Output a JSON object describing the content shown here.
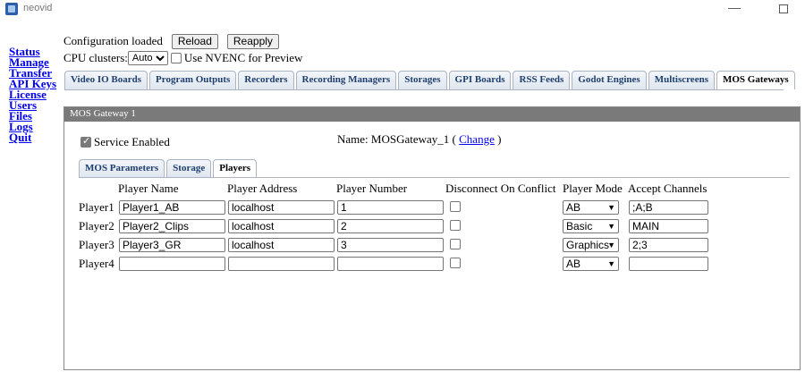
{
  "window": {
    "title": "neovid"
  },
  "nav": {
    "items": [
      "Status",
      "Manage",
      "Transfer",
      "API Keys",
      "License",
      "Users",
      "Files",
      "Logs",
      "Quit"
    ]
  },
  "top": {
    "status_text": "Configuration loaded",
    "reload_label": "Reload",
    "reapply_label": "Reapply",
    "cpu_label": "CPU clusters:",
    "cpu_value": "Auto",
    "nvenc_label": "Use NVENC for Preview"
  },
  "tabs": [
    "Video IO Boards",
    "Program Outputs",
    "Recorders",
    "Recording Managers",
    "Storages",
    "GPI Boards",
    "RSS Feeds",
    "Godot Engines",
    "Multiscreens",
    "MOS Gateways"
  ],
  "panel": {
    "title": "MOS Gateway 1",
    "service_label": "Service Enabled",
    "name_prefix": "Name:",
    "name_value": "MOSGateway_1",
    "paren_open": "(",
    "change_label": "Change",
    "paren_close": ")",
    "subtabs": [
      "MOS Parameters",
      "Storage",
      "Players"
    ]
  },
  "players_table": {
    "headers": {
      "name": "Player Name",
      "address": "Player Address",
      "number": "Player Number",
      "disconnect": "Disconnect On Conflict",
      "mode": "Player Mode",
      "channels": "Accept Channels"
    },
    "rows": [
      {
        "label": "Player1",
        "name": "Player1_AB",
        "address": "localhost",
        "number": "1",
        "mode": "AB",
        "channels": ";A;B"
      },
      {
        "label": "Player2",
        "name": "Player2_Clips",
        "address": "localhost",
        "number": "2",
        "mode": "Basic",
        "channels": "MAIN"
      },
      {
        "label": "Player3",
        "name": "Player3_GR",
        "address": "localhost",
        "number": "3",
        "mode": "Graphics",
        "channels": "2;3"
      },
      {
        "label": "Player4",
        "name": "",
        "address": "",
        "number": "",
        "mode": "AB",
        "channels": ""
      }
    ]
  }
}
